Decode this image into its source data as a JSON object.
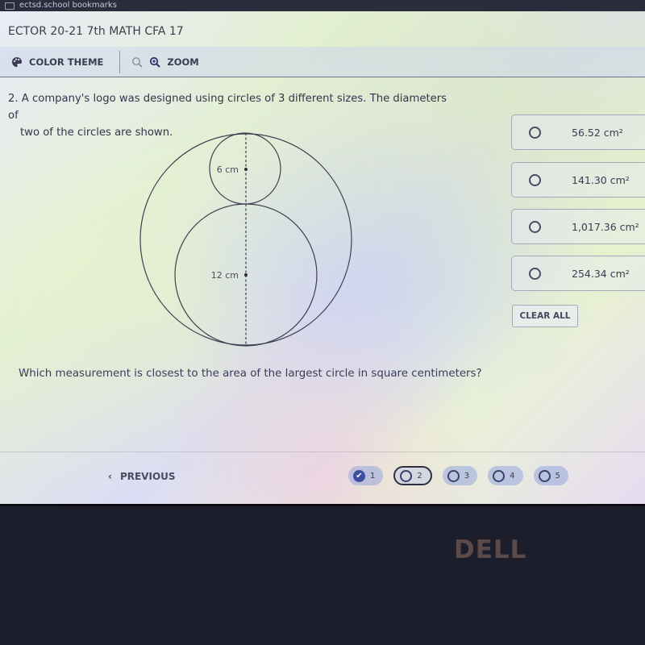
{
  "browser": {
    "bookmarks_label": "ectsd.school bookmarks"
  },
  "app": {
    "title": "ECTOR 20-21 7th MATH CFA 17"
  },
  "toolbar": {
    "color_theme_label": "COLOR THEME",
    "zoom_label": "ZOOM",
    "icons": [
      "palette-icon",
      "zoom-out-icon",
      "zoom-in-icon"
    ]
  },
  "question": {
    "number": "2.",
    "text_line1": "A company's logo was designed using circles of 3 different sizes. The diameters of",
    "text_line2": "two of the circles are shown.",
    "prompt": "Which measurement is closest to the area of the largest circle in square centimeters?",
    "diagram": {
      "small_label": "6 cm",
      "medium_label": "12 cm"
    }
  },
  "answers": [
    {
      "value": "56.52 cm²",
      "selected": false
    },
    {
      "value": "141.30 cm²",
      "selected": false
    },
    {
      "value": "1,017.36 cm²",
      "selected": false
    },
    {
      "value": "254.34 cm²",
      "selected": false
    }
  ],
  "clear_all_label": "CLEAR ALL",
  "navigation": {
    "previous_label": "PREVIOUS",
    "pages": [
      {
        "label": "1",
        "state": "answered"
      },
      {
        "label": "2",
        "state": "current"
      },
      {
        "label": "3",
        "state": "unanswered"
      },
      {
        "label": "4",
        "state": "unanswered"
      },
      {
        "label": "5",
        "state": "unanswered"
      }
    ]
  },
  "device": {
    "brand_logo": "DELL"
  }
}
